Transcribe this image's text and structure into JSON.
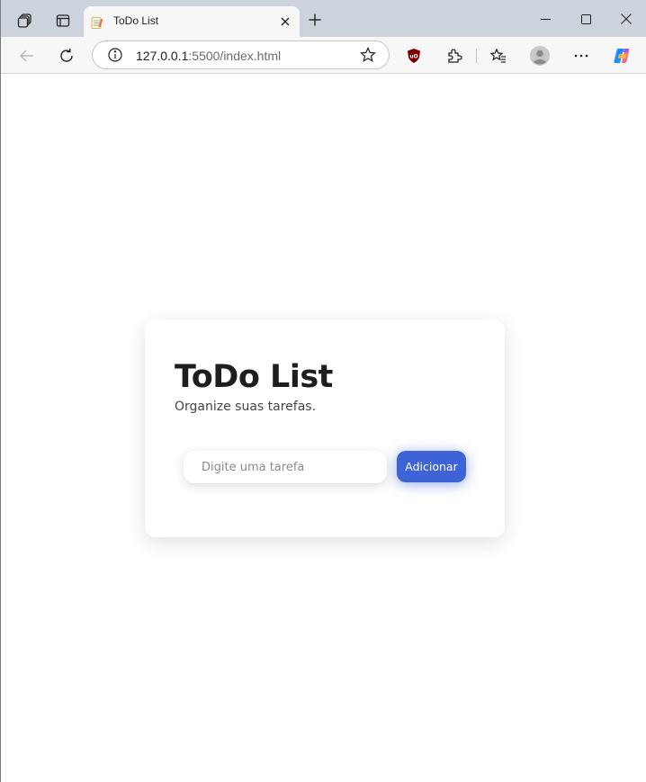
{
  "browser": {
    "tab_title": "ToDo List",
    "url_host": "127.0.0.1",
    "url_rest": ":5500/index.html",
    "colors": {
      "tabbar": "#cdd3dc",
      "toolbar": "#f7f7f7"
    },
    "icons": [
      "workspaces-icon",
      "tab-actions-icon",
      "back-arrow-icon",
      "refresh-icon",
      "info-icon",
      "star-icon",
      "ublock-icon",
      "extensions-icon",
      "favorites-icon",
      "profile-icon",
      "more-icon",
      "copilot-icon"
    ]
  },
  "app": {
    "title": "ToDo List",
    "subtitle": "Organize suas tarefas.",
    "input_placeholder": "Digite uma tarefa",
    "add_label": "Adicionar",
    "accent_color": "#3d63d6"
  }
}
